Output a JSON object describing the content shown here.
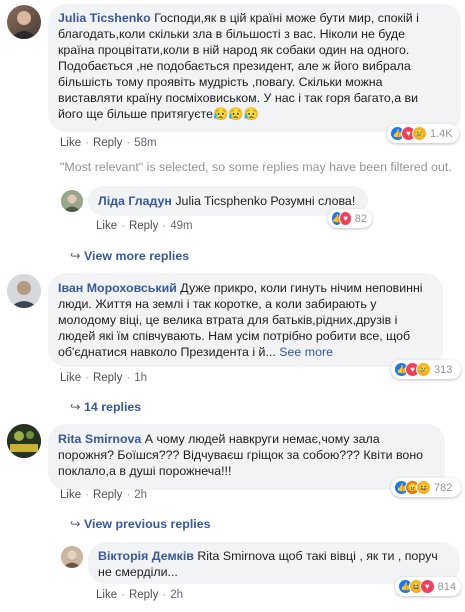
{
  "comments": [
    {
      "author": "Julia Ticshenko",
      "text": "Господи,як в цій країні може бути мир, спокій і\nблагодать,коли скільки зла в більшості з вас. Ніколи не буде\nкраїна процвітати,коли в ній народ як собаки один на одного.\nПодобається ,не подобається президент, але ж його вибрала\nбільшість тому проявіть мудрість ,повагу. Скільки можна\nвиставляти країну посміховиськом. У нас і так горя багато,а ви\nйого ще більше притягуєте",
      "emoji": "😥😥😥",
      "like": "Like",
      "reply": "Reply",
      "time": "58m",
      "reactions": [
        "like-icon",
        "love-icon",
        "sad-icon"
      ],
      "reaction_count": "1.4K"
    },
    {
      "author": "Ліда Гладун",
      "text": "Julia Ticsphenko Розумні слова!",
      "like": "Like",
      "reply": "Reply",
      "time": "49m",
      "reactions": [
        "like-icon",
        "love-icon"
      ],
      "reaction_count": "82"
    },
    {
      "author": "Іван Мороховський",
      "text": "Дуже прикро, коли гинуть нічим неповинні\nлюди. Життя на землі і так коротке, а коли забирають у\nмолодому віці, це велика втрата для батьків,рідних,друзів і\nлюдей які їм співчувають. Нам усім потрібно робити все, щоб\nоб'єднатися навколо Президента і й...",
      "see_more": "See more",
      "like": "Like",
      "reply": "Reply",
      "time": "1h",
      "reactions": [
        "like-icon",
        "love-icon",
        "sad-icon"
      ],
      "reaction_count": "313"
    },
    {
      "author": "Rita Smirnova",
      "text": "А чому людей навкруги немає,чому зала\nпорожня? Боїшся??? Відчуваєш гріщок за собою??? Квіти воно\nпоклало,а в душі порожнеча!!!",
      "like": "Like",
      "reply": "Reply",
      "time": "2h",
      "reactions": [
        "like-icon",
        "angry-icon",
        "haha-icon"
      ],
      "reaction_count": "782"
    },
    {
      "author": "Вікторія Демків",
      "text": "Rita Smirnova щоб такі вівці , як ти , поруч\nне смерділи...",
      "like": "Like",
      "reply": "Reply",
      "time": "2h",
      "reactions": [
        "like-icon",
        "haha-icon",
        "love-icon"
      ],
      "reaction_count": "814"
    }
  ],
  "notice": "\"Most relevant\" is selected, so some replies may have been filtered out.",
  "view_more_replies": "View more replies",
  "replies_count": "14 replies",
  "view_previous_replies": "View previous replies",
  "colors": {
    "link": "#385898",
    "bubble": "#f2f3f5",
    "meta": "#606770",
    "like": "#1877f2",
    "love": "#f33e58"
  }
}
